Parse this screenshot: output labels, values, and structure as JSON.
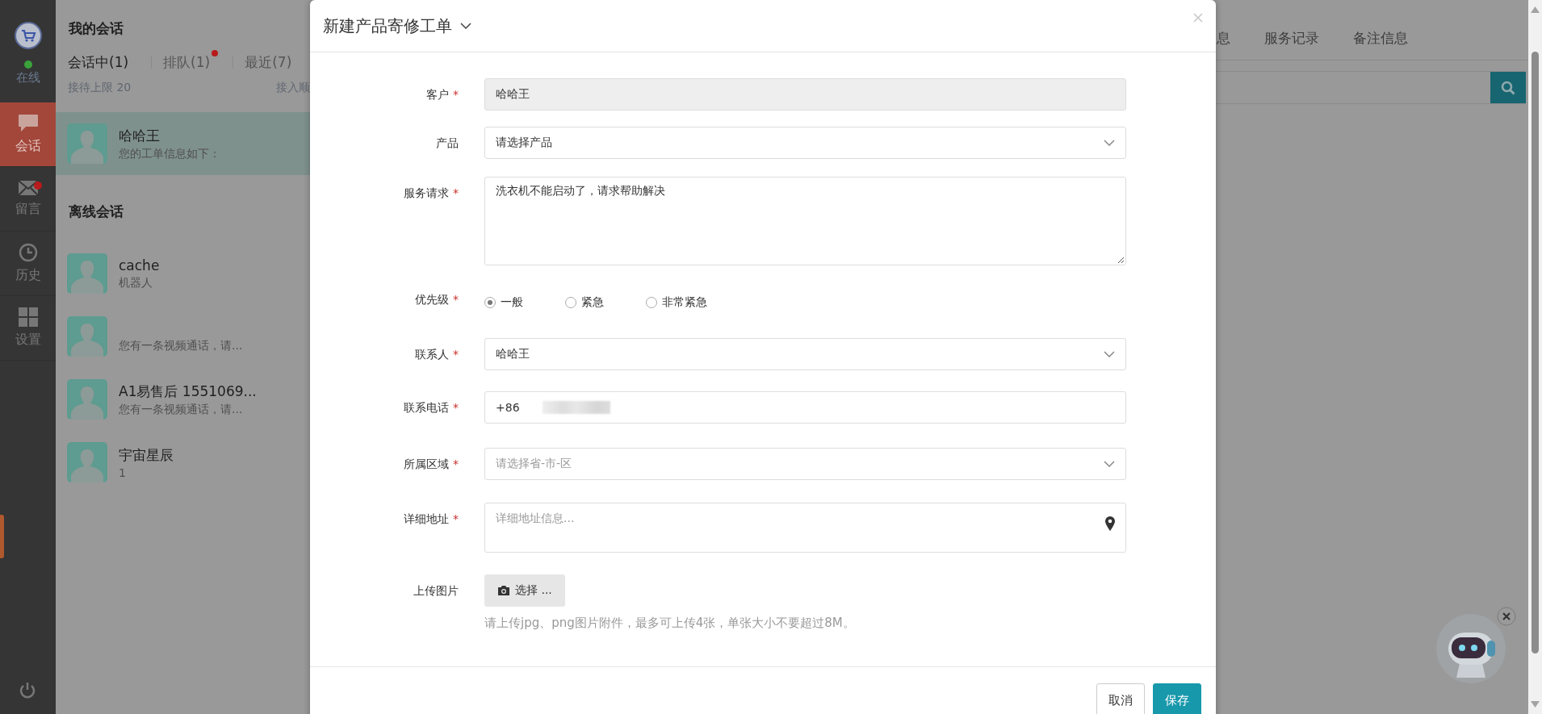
{
  "sidebar": {
    "status": "在线",
    "online": true,
    "items": [
      {
        "label": "会话",
        "selected": true,
        "badge": false
      },
      {
        "label": "留言",
        "selected": false,
        "badge": true
      },
      {
        "label": "历史",
        "selected": false,
        "badge": false
      },
      {
        "label": "设置",
        "selected": false,
        "badge": false
      }
    ]
  },
  "conversations": {
    "title": "我的会话",
    "tabs": [
      {
        "label": "会话中(1)",
        "selected": true,
        "badge": false
      },
      {
        "label": "排队(1)",
        "selected": false,
        "badge": true
      },
      {
        "label": "最近(7)",
        "selected": false,
        "badge": false
      }
    ],
    "limit": "接待上限 20",
    "order": "接入顺",
    "active": [
      {
        "name": "哈哈王",
        "preview": "您的工单信息如下：",
        "selected": true
      }
    ],
    "offline_title": "离线会话",
    "offline": [
      {
        "name": "cache",
        "preview": "机器人",
        "selected": false
      },
      {
        "preview": "您有一条视频通话，请...",
        "selected": false
      },
      {
        "name": "A1易售后 1551069...",
        "preview": "您有一条视频通话，请...",
        "selected": false
      },
      {
        "name": "宇宙星辰",
        "preview": "1",
        "selected": false
      }
    ]
  },
  "detail_tabs": [
    "息",
    "服务记录",
    "备注信息"
  ],
  "modal": {
    "title": "新建产品寄修工单",
    "fields": [
      {
        "kind": "readonly",
        "label": "客户",
        "required_mark": "*",
        "value": "哈哈王"
      },
      {
        "kind": "select",
        "label": "产品",
        "value": "请选择产品"
      },
      {
        "kind": "textarea",
        "label": "服务请求",
        "required_mark": "*",
        "value": "洗衣机不能启动了，请求帮助解决"
      },
      {
        "kind": "radio",
        "label": "优先级",
        "required_mark": "*",
        "options": [
          {
            "label": "一般",
            "selected": true
          },
          {
            "label": "紧急",
            "selected": false
          },
          {
            "label": "非常紧急",
            "selected": false
          }
        ]
      },
      {
        "kind": "select",
        "label": "联系人",
        "required_mark": "*",
        "value": "哈哈王"
      },
      {
        "kind": "phone",
        "label": "联系电话",
        "required_mark": "*",
        "prefix": "+86"
      },
      {
        "kind": "select",
        "label": "所属区域",
        "required_mark": "*",
        "placeholder": "请选择省-市-区"
      },
      {
        "kind": "address",
        "label": "详细地址",
        "required_mark": "*",
        "placeholder": "详细地址信息..."
      },
      {
        "kind": "upload",
        "label": "上传图片",
        "button": "选择 ...",
        "hint": "请上传jpg、png图片附件，最多可上传4张，单张大小不要超过8M。"
      }
    ],
    "buttons": [
      {
        "label": "取消",
        "kind": "default"
      },
      {
        "label": "保存",
        "kind": "primary"
      }
    ]
  }
}
